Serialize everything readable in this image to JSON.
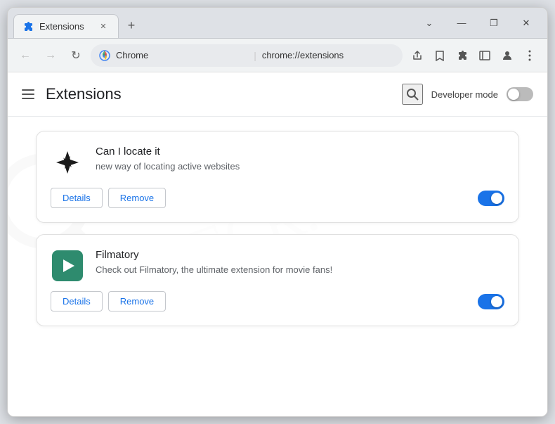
{
  "browser": {
    "tab": {
      "title": "Extensions",
      "favicon": "puzzle-piece"
    },
    "new_tab_label": "+",
    "address": {
      "protocol": "chrome://extensions",
      "display_chrome": "Chrome",
      "divider": "|"
    },
    "window_controls": {
      "minimize": "—",
      "maximize": "❐",
      "close": "✕",
      "restore": "⌄"
    }
  },
  "page": {
    "title": "Extensions",
    "hamburger_label": "Menu",
    "search_label": "Search",
    "developer_mode": {
      "label": "Developer mode",
      "enabled": false
    }
  },
  "extensions": [
    {
      "id": "ext-1",
      "name": "Can I locate it",
      "description": "new way of locating active websites",
      "icon_type": "bird",
      "enabled": true,
      "details_label": "Details",
      "remove_label": "Remove"
    },
    {
      "id": "ext-2",
      "name": "Filmatory",
      "description": "Check out Filmatory, the ultimate extension for movie fans!",
      "icon_type": "filmatory",
      "enabled": true,
      "details_label": "Details",
      "remove_label": "Remove"
    }
  ]
}
